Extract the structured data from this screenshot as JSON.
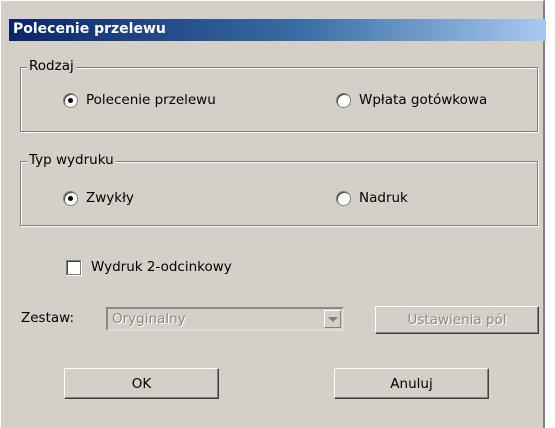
{
  "window": {
    "title": "Polecenie przelewu"
  },
  "rodzaj": {
    "legend": "Rodzaj",
    "options": [
      {
        "label": "Polecenie przelewu",
        "selected": true
      },
      {
        "label": "Wpłata gotówkowa",
        "selected": false
      }
    ]
  },
  "typ_wydruku": {
    "legend": "Typ wydruku",
    "options": [
      {
        "label": "Zwykły",
        "selected": true
      },
      {
        "label": "Nadruk",
        "selected": false
      }
    ]
  },
  "wydruk_checkbox": {
    "label": "Wydruk 2-odcinkowy",
    "checked": false
  },
  "zestaw": {
    "label": "Zestaw:",
    "value": "Oryginalny",
    "enabled": false
  },
  "buttons": {
    "ustawienia": "Ustawienia pól",
    "ok": "OK",
    "cancel": "Anuluj"
  }
}
